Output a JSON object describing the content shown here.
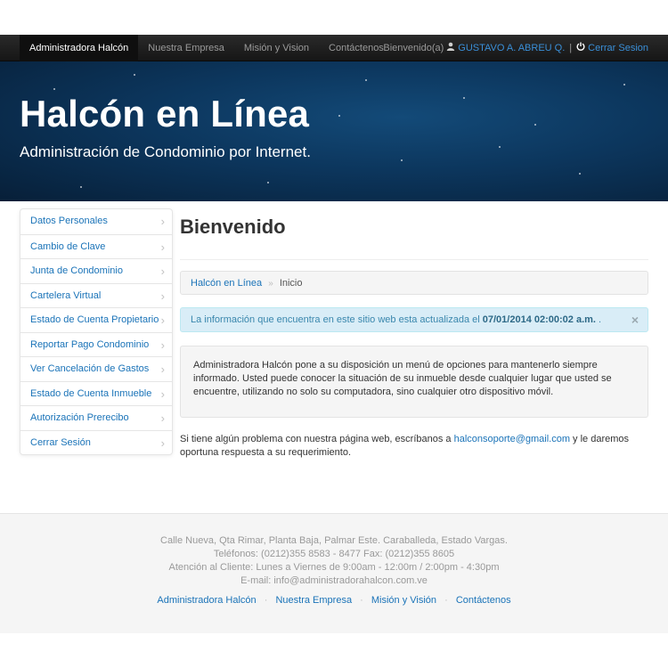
{
  "navbar": {
    "brand": "Administradora Halcón",
    "links": [
      "Nuestra Empresa",
      "Misión y Vision",
      "Contáctenos"
    ],
    "welcome": "Bienvenido(a)",
    "user_name": "GUSTAVO A. ABREU Q.",
    "separator": "|",
    "logout": "Cerrar Sesion"
  },
  "hero": {
    "title": "Halcón en Línea",
    "subtitle": "Administración de Condominio por Internet."
  },
  "sidebar": {
    "items": [
      {
        "label": "Datos Personales",
        "icon": "chevron-right-icon"
      },
      {
        "label": "Cambio de Clave",
        "icon": "chevron-right-icon"
      },
      {
        "label": "Junta de Condominio",
        "icon": "chevron-right-icon"
      },
      {
        "label": "Cartelera Virtual",
        "icon": "chevron-right-icon"
      },
      {
        "label": "Estado de Cuenta Propietario",
        "icon": "chevron-right-icon"
      },
      {
        "label": "Reportar Pago Condominio",
        "icon": "chevron-right-icon"
      },
      {
        "label": "Ver Cancelación de Gastos",
        "icon": "chevron-right-icon"
      },
      {
        "label": "Estado de Cuenta Inmueble",
        "icon": "chevron-right-icon"
      },
      {
        "label": "Autorización Prerecibo",
        "icon": "chevron-right-icon"
      },
      {
        "label": "Cerrar Sesión",
        "icon": "chevron-right-icon"
      }
    ]
  },
  "main": {
    "title": "Bienvenido",
    "breadcrumb": {
      "home": "Halcón en Línea",
      "separator": "»",
      "current": "Inicio"
    },
    "alert": {
      "text": "La información que encuentra en este sitio web esta actualizada el ",
      "date": "07/01/2014 02:00:02 a.m.",
      "suffix": " .",
      "close": "×"
    },
    "well_text": "Administradora Halcón pone a su disposición un menú de opciones para mantenerlo siempre informado. Usted puede conocer la situación de su inmueble desde cualquier lugar que usted se encuentre, utilizando no solo su computadora, sino cualquier otro dispositivo móvil.",
    "support": {
      "before": "Si tiene algún problema con nuestra página web, escríbanos a ",
      "email": "halconsoporte@gmail.com",
      "after": " y le daremos oportuna respuesta a su requerimiento."
    }
  },
  "footer": {
    "address": "Calle Nueva, Qta Rimar, Planta Baja, Palmar Este. Caraballeda, Estado Vargas.",
    "phones": "Teléfonos: (0212)355 8583 - 8477 Fax: (0212)355 8605",
    "hours": "Atención al Cliente: Lunes a Viernes de 9:00am - 12:00m / 2:00pm - 4:30pm",
    "email": "E-mail: info@administradorahalcon.com.ve",
    "links": [
      "Administradora Halcón",
      "Nuestra Empresa",
      "Misión y Visión",
      "Contáctenos"
    ],
    "link_separator": "·"
  },
  "colors": {
    "link": "#1a73b8",
    "navbar_bg": "#1f1f1f",
    "hero_bg": "#0c365d",
    "alert_bg": "#d9edf7",
    "alert_text": "#3a87ad",
    "footer_bg": "#f5f5f5"
  }
}
